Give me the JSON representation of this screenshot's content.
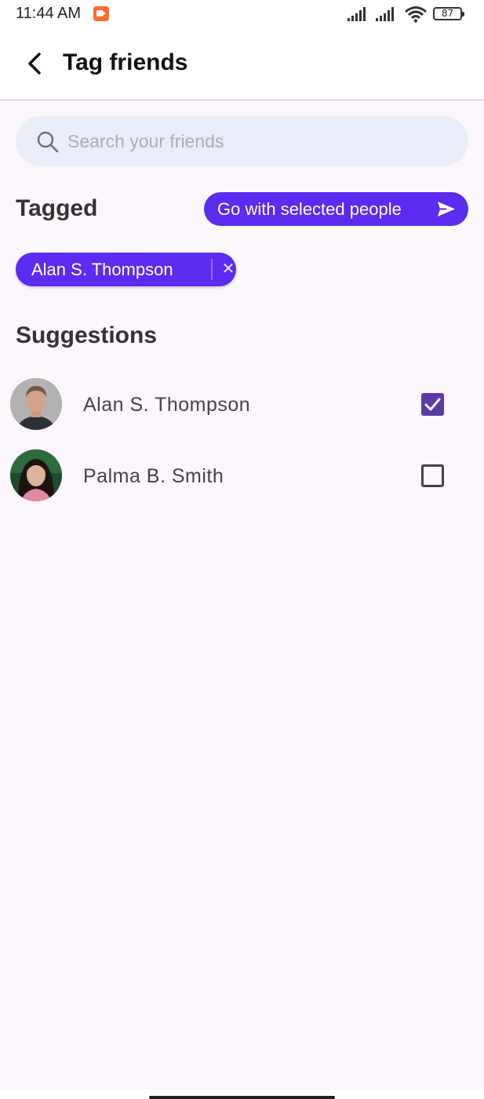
{
  "status_bar": {
    "time": "11:44 AM",
    "battery": "87",
    "icons": [
      "record-icon",
      "signal-icon",
      "signal-icon",
      "wifi-icon",
      "battery-icon"
    ]
  },
  "header": {
    "title": "Tag friends",
    "back_icon": "back-arrow-icon"
  },
  "search": {
    "placeholder": "Search your friends",
    "value": "",
    "icon": "search-icon"
  },
  "tagged": {
    "title": "Tagged",
    "go_button_label": "Go with selected people",
    "go_button_icon": "send-icon",
    "chips": [
      {
        "label": "Alan S. Thompson",
        "remove_icon": "close-icon"
      }
    ]
  },
  "suggestions": {
    "title": "Suggestions",
    "items": [
      {
        "name": "Alan S. Thompson",
        "checked": true
      },
      {
        "name": "Palma B. Smith",
        "checked": false
      }
    ]
  },
  "colors": {
    "accent": "#5b2bf0",
    "checkbox_checked": "#5c3aa6",
    "background": "#fcf6fd",
    "search_bg": "#e9edf7"
  }
}
